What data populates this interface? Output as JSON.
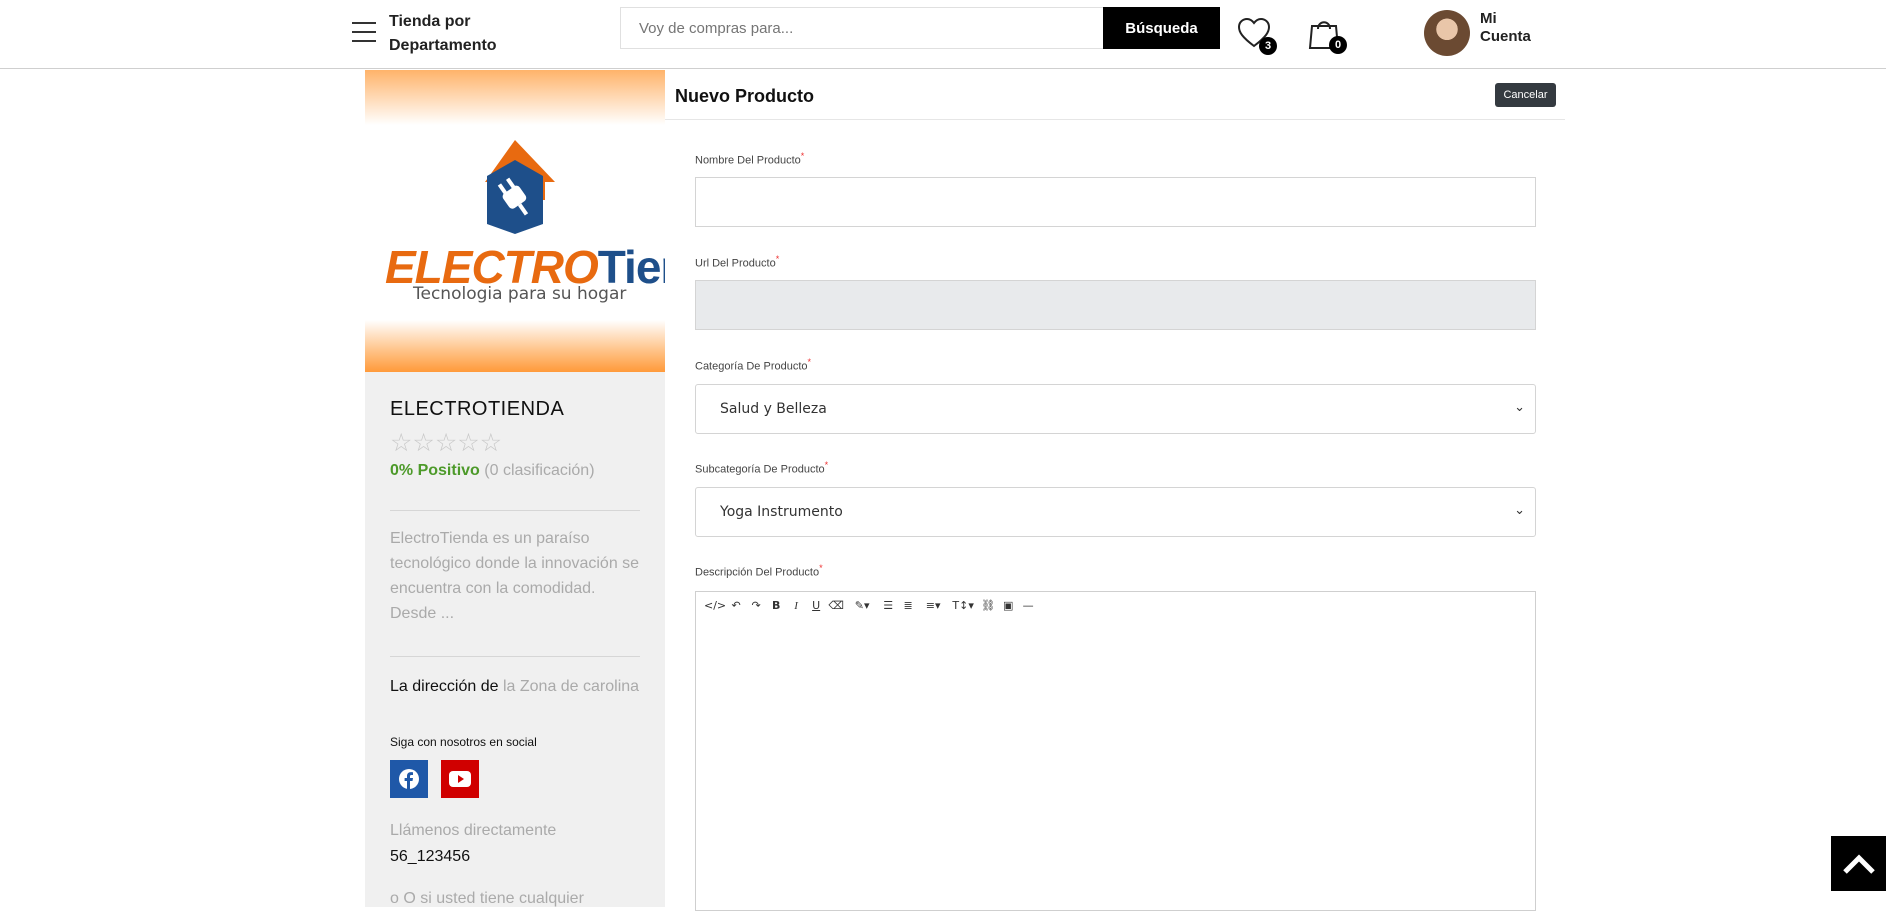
{
  "header": {
    "dept_label": "Tienda por Departamento",
    "search_placeholder": "Voy de compras para...",
    "search_button": "Búsqueda",
    "wishlist_count": "3",
    "cart_count": "0",
    "account_label": "Mi Cuenta"
  },
  "sidebar": {
    "logo_part1": "ELECTRO",
    "logo_part2": "Tienda",
    "logo_tagline": "Tecnologia para su hogar",
    "store_name": "ELECTROTIENDA",
    "stars": "☆☆☆☆☆",
    "rating_positive": "0% Positivo",
    "rating_count": "(0 clasificación)",
    "description": "ElectroTienda es un paraíso tecnológico donde la innovación se encuentra con la comodidad. Desde ...",
    "address_label": "La dirección de",
    "address_value": "la Zona de carolina",
    "follow_label": "Siga con nosotros en social",
    "call_label": "Llámenos directamente",
    "phone": "56_123456",
    "more_text": "o O si usted tiene cualquier"
  },
  "form": {
    "title": "Nuevo Producto",
    "cancel": "Cancelar",
    "name_label": "Nombre Del Producto",
    "name_value": "",
    "url_label": "Url Del Producto",
    "url_value": "",
    "category_label": "Categoría De Producto",
    "category_value": "Salud y Belleza",
    "subcategory_label": "Subcategoría De Producto",
    "subcategory_value": "Yoga Instrumento",
    "description_label": "Descripción Del Producto",
    "required_mark": "*"
  },
  "colors": {
    "accent_orange": "#e86a10",
    "brand_blue": "#1e4f8a",
    "positive_green": "#4d9a2a",
    "facebook": "#1f58a8",
    "youtube": "#d00000"
  }
}
